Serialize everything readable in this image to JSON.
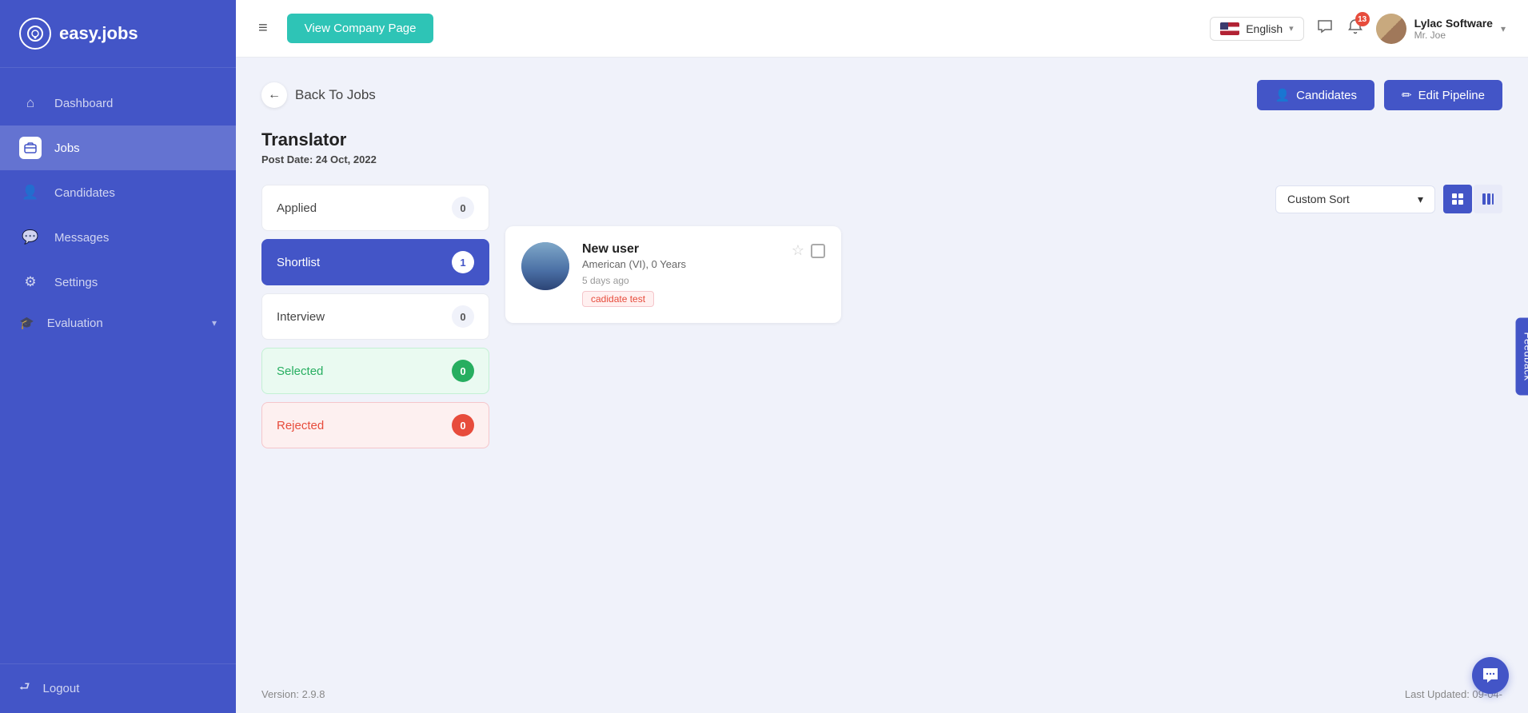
{
  "sidebar": {
    "logo_text": "easy.jobs",
    "items": [
      {
        "id": "dashboard",
        "label": "Dashboard",
        "icon": "⌂",
        "active": false
      },
      {
        "id": "jobs",
        "label": "Jobs",
        "icon": "💼",
        "active": true
      },
      {
        "id": "candidates",
        "label": "Candidates",
        "icon": "👤",
        "active": false
      },
      {
        "id": "messages",
        "label": "Messages",
        "icon": "💬",
        "active": false
      },
      {
        "id": "settings",
        "label": "Settings",
        "icon": "⚙",
        "active": false
      },
      {
        "id": "evaluation",
        "label": "Evaluation",
        "icon": "🎓",
        "active": false
      }
    ],
    "logout_label": "Logout"
  },
  "topbar": {
    "menu_icon": "≡",
    "view_company_btn": "View Company Page",
    "language": "English",
    "notification_count": "13",
    "user_name": "Lylac Software",
    "user_role": "Mr. Joe"
  },
  "page": {
    "back_label": "Back To Jobs",
    "candidates_btn": "Candidates",
    "edit_pipeline_btn": "Edit Pipeline",
    "job_title": "Translator",
    "post_date_label": "Post Date:",
    "post_date_value": "24 Oct, 2022",
    "sort_label": "Custom Sort",
    "stages": [
      {
        "id": "applied",
        "label": "Applied",
        "count": "0",
        "active": false,
        "type": "normal"
      },
      {
        "id": "shortlist",
        "label": "Shortlist",
        "count": "1",
        "active": true,
        "type": "active"
      },
      {
        "id": "interview",
        "label": "Interview",
        "count": "0",
        "active": false,
        "type": "normal"
      },
      {
        "id": "selected",
        "label": "Selected",
        "count": "0",
        "active": false,
        "type": "selected"
      },
      {
        "id": "rejected",
        "label": "Rejected",
        "count": "0",
        "active": false,
        "type": "rejected"
      }
    ],
    "candidate": {
      "name": "New user",
      "location": "American (VI), 0 Years",
      "time": "5 days ago",
      "tag": "cadidate test"
    },
    "version": "Version: 2.9.8",
    "last_updated": "Last Updated: 09-04-"
  },
  "feedback_label": "Feedback"
}
